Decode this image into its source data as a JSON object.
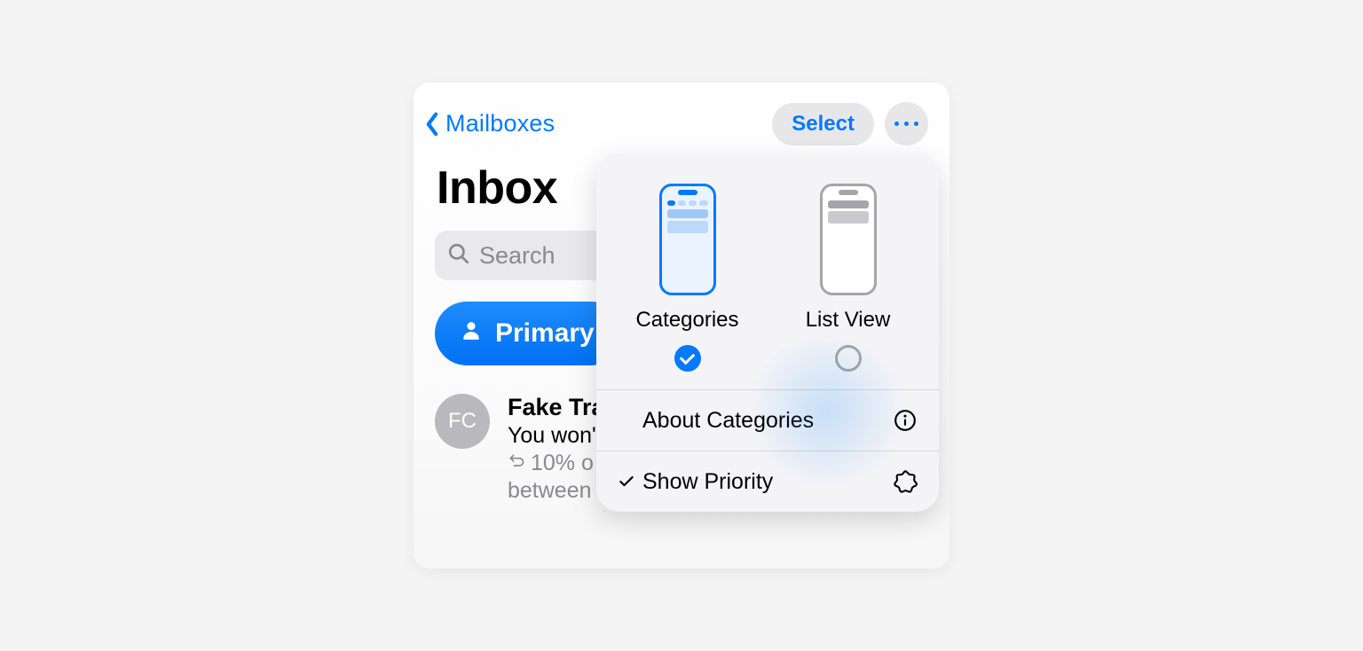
{
  "nav": {
    "back_label": "Mailboxes",
    "select_label": "Select"
  },
  "page": {
    "title": "Inbox",
    "search_placeholder": "Search"
  },
  "tabs": {
    "primary_label": "Primary"
  },
  "mail": {
    "avatar_initials": "FC",
    "sender": "Fake Tra",
    "subject": "You won'",
    "preview_line1": "10% o",
    "preview_line2": "between"
  },
  "popover": {
    "option_categories": "Categories",
    "option_list_view": "List View",
    "selected": "categories",
    "about_label": "About Categories",
    "priority_label": "Show Priority",
    "priority_checked": true
  }
}
